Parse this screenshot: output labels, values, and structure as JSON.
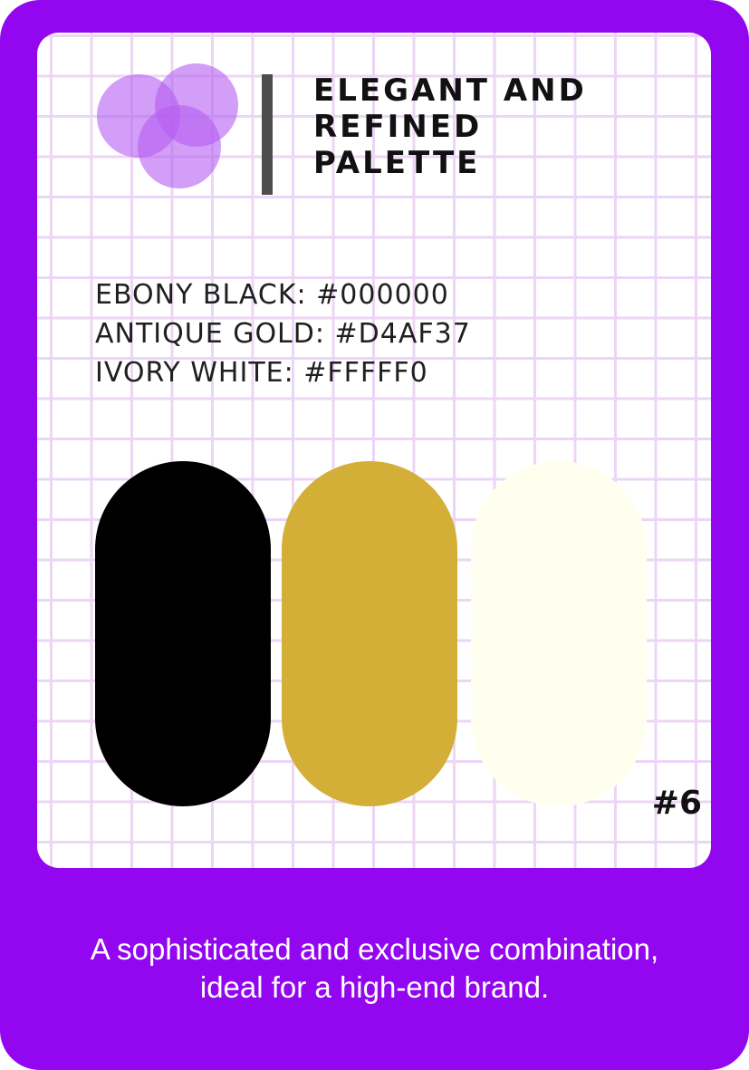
{
  "card": {
    "title_lines": [
      "ELEGANT AND",
      "REFINED",
      "PALETTE"
    ],
    "colors": [
      {
        "label": "EBONY BLACK: #000000",
        "hex": "#000000"
      },
      {
        "label": "ANTIQUE GOLD: #D4AF37",
        "hex": "#D4AF37"
      },
      {
        "label": "IVORY WHITE: #FFFFF0",
        "hex": "#FFFFF0"
      }
    ],
    "number": "#6",
    "caption_lines": [
      "A sophisticated and exclusive combination,",
      "ideal for a high-end brand."
    ]
  },
  "theme": {
    "frame": "#9206F0",
    "grid_line": "#ECD6F5",
    "logo_circle": "#B65EF2"
  },
  "icons": {
    "logo": "three-overlapping-circles-logo"
  }
}
